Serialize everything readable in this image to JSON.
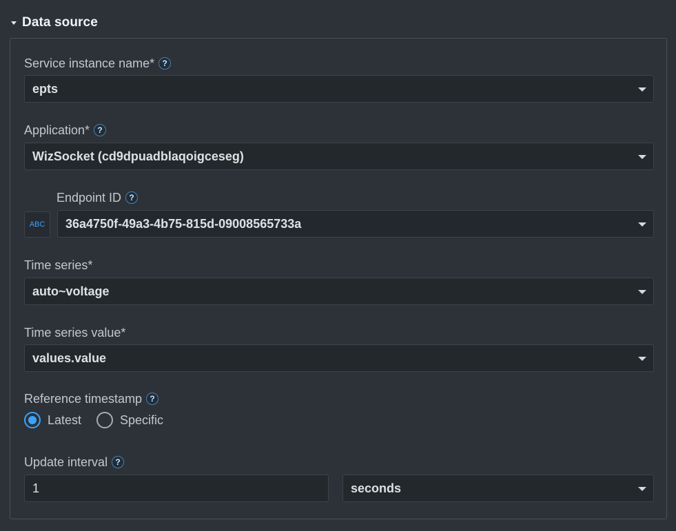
{
  "section": {
    "title": "Data source"
  },
  "fields": {
    "service_instance": {
      "label": "Service instance name*",
      "value": "epts"
    },
    "application": {
      "label": "Application*",
      "value": "WizSocket (cd9dpuadblaqoigceseg)"
    },
    "endpoint": {
      "label": "Endpoint ID",
      "value": "36a4750f-49a3-4b75-815d-09008565733a",
      "toggle": "ABC"
    },
    "time_series": {
      "label": "Time series*",
      "value": "auto~voltage"
    },
    "time_series_value": {
      "label": "Time series value*",
      "value": "values.value"
    },
    "reference_timestamp": {
      "label": "Reference timestamp",
      "options": [
        {
          "label": "Latest",
          "selected": true
        },
        {
          "label": "Specific",
          "selected": false
        }
      ]
    },
    "update_interval": {
      "label": "Update interval",
      "value": "1",
      "unit": "seconds"
    }
  },
  "help_glyph": "?",
  "colors": {
    "accent": "#3ba3ff",
    "background": "#2c3238",
    "field_bg": "#23282d"
  }
}
